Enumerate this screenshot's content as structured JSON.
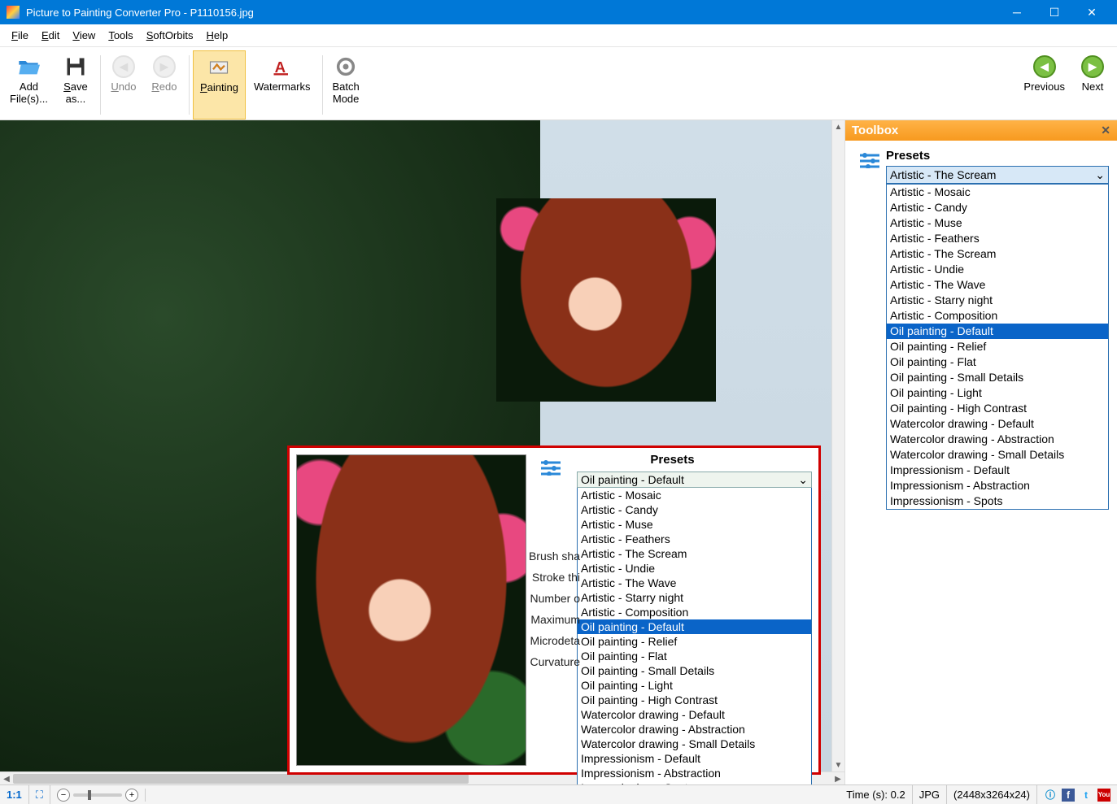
{
  "titlebar": {
    "title": "Picture to Painting Converter Pro - P1110156.jpg"
  },
  "menubar": [
    {
      "label": "File",
      "accel": "F"
    },
    {
      "label": "Edit",
      "accel": "E"
    },
    {
      "label": "View",
      "accel": "V"
    },
    {
      "label": "Tools",
      "accel": "T"
    },
    {
      "label": "SoftOrbits",
      "accel": "S"
    },
    {
      "label": "Help",
      "accel": "H"
    }
  ],
  "toolbar": {
    "add": {
      "line1": "Add",
      "line2": "File(s)..."
    },
    "save": {
      "line1": "Save",
      "line2": "as...",
      "accel": "S"
    },
    "undo": "Undo",
    "redo": "Redo",
    "painting": "Painting",
    "watermarks": "Watermarks",
    "batch": {
      "line1": "Batch",
      "line2": "Mode"
    },
    "previous": "Previous",
    "next": "Next"
  },
  "toolbox": {
    "title": "Toolbox",
    "section": "Presets",
    "selected": "Artistic - The Scream",
    "highlighted": "Oil painting - Default",
    "options": [
      "Artistic - Mosaic",
      "Artistic - Candy",
      "Artistic - Muse",
      "Artistic - Feathers",
      "Artistic - The Scream",
      "Artistic - Undie",
      "Artistic - The Wave",
      "Artistic - Starry night",
      "Artistic - Composition",
      "Oil painting - Default",
      "Oil painting - Relief",
      "Oil painting - Flat",
      "Oil painting - Small Details",
      "Oil painting - Light",
      "Oil painting - High Contrast",
      "Watercolor drawing - Default",
      "Watercolor drawing - Abstraction",
      "Watercolor drawing - Small Details",
      "Impressionism - Default",
      "Impressionism - Abstraction",
      "Impressionism - Spots"
    ]
  },
  "inset": {
    "section": "Presets",
    "selected": "Oil painting - Default",
    "highlighted": "Oil painting - Default",
    "options": [
      "Artistic - Mosaic",
      "Artistic - Candy",
      "Artistic - Muse",
      "Artistic - Feathers",
      "Artistic - The Scream",
      "Artistic - Undie",
      "Artistic - The Wave",
      "Artistic - Starry night",
      "Artistic - Composition",
      "Oil painting - Default",
      "Oil painting - Relief",
      "Oil painting - Flat",
      "Oil painting - Small Details",
      "Oil painting - Light",
      "Oil painting - High Contrast",
      "Watercolor drawing - Default",
      "Watercolor drawing - Abstraction",
      "Watercolor drawing - Small Details",
      "Impressionism - Default",
      "Impressionism - Abstraction",
      "Impressionism - Spots"
    ],
    "labels": [
      "Brush sha",
      "Stroke thi",
      "Number o",
      "Maximum",
      "Microdeta",
      "Curvature"
    ]
  },
  "status": {
    "ratio": "1:1",
    "time": "Time (s): 0.2",
    "format": "JPG",
    "dims": "(2448x3264x24)"
  }
}
